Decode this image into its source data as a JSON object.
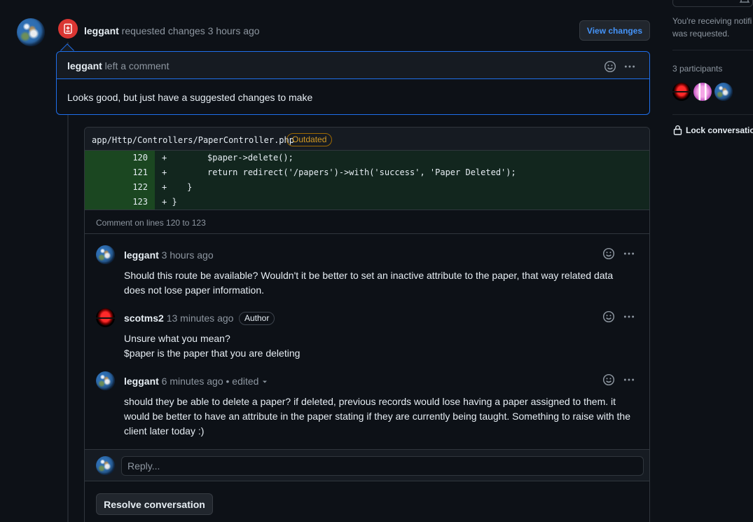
{
  "timeline_event": {
    "author": "leggant",
    "action": "requested changes 3 hours ago",
    "view_changes_label": "View changes"
  },
  "review_comment": {
    "author": "leggant",
    "action": "left a comment",
    "body": "Looks good, but just have a suggested changes to make"
  },
  "thread": {
    "file_path": "app/Http/Controllers/PaperController.php",
    "outdated_label": "Outdated",
    "diff_lines": [
      {
        "num": "120",
        "code": "+        $paper->delete();"
      },
      {
        "num": "121",
        "code": "+        return redirect('/papers')->with('success', 'Paper Deleted');"
      },
      {
        "num": "122",
        "code": "+    }"
      },
      {
        "num": "123",
        "code": "+ }"
      }
    ],
    "comment_on": "Comment on lines 120 to 123",
    "comments": [
      {
        "author": "leggant",
        "time": "3 hours ago",
        "body_lines": [
          "Should this route be available? Wouldn't it be better to set an inactive attribute to the paper, that way related data",
          "does not lose paper information."
        ]
      },
      {
        "author": "scotms2",
        "time": "13 minutes ago",
        "badge": "Author",
        "body_lines": [
          "Unsure what you mean?",
          "$paper is the paper that you are deleting"
        ]
      },
      {
        "author": "leggant",
        "time": "6 minutes ago",
        "edited": "• edited",
        "body_lines": [
          "should they be able to delete a paper? if deleted, previous records would lose having a paper assigned to them. it",
          "would be better to have an attribute in the paper stating if they are currently being taught. Something to raise with the",
          "client later today :)"
        ]
      }
    ],
    "reply_placeholder": "Reply...",
    "resolve_label": "Resolve conversation"
  },
  "sidebar": {
    "notify_lines": [
      "You're receiving notifi",
      "was requested."
    ],
    "participants_label": "3 participants",
    "lock_label": "Lock conversation"
  }
}
